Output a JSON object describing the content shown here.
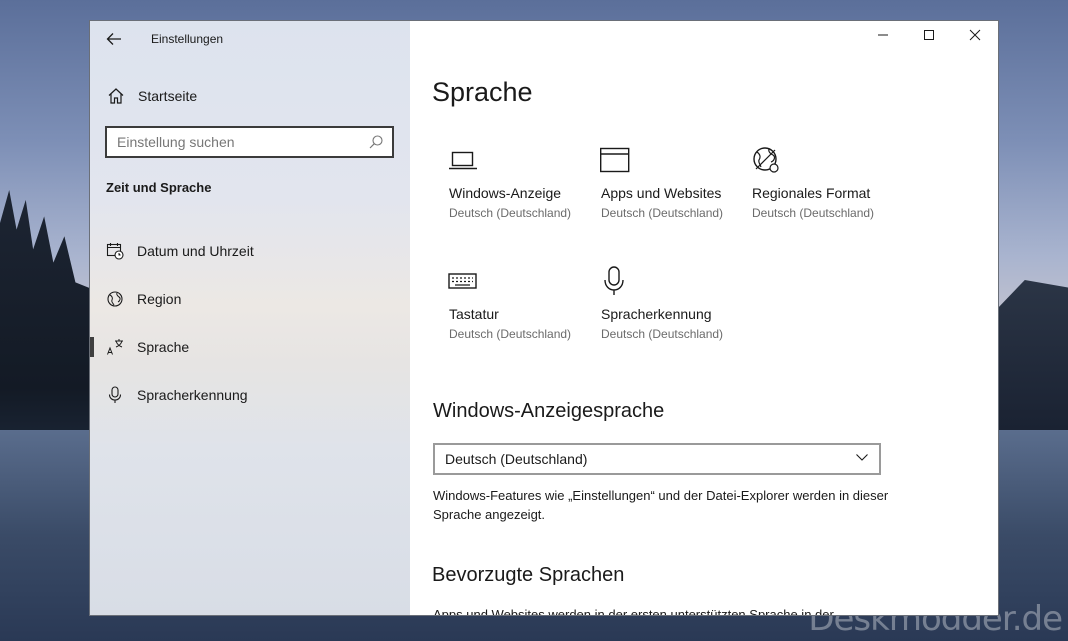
{
  "window": {
    "title": "Einstellungen"
  },
  "sidebar": {
    "home_label": "Startseite",
    "search_placeholder": "Einstellung suchen",
    "section_title": "Zeit und Sprache",
    "items": [
      {
        "label": "Datum und Uhrzeit",
        "icon": "calendar-clock-icon",
        "active": false
      },
      {
        "label": "Region",
        "icon": "globe-icon",
        "active": false
      },
      {
        "label": "Sprache",
        "icon": "language-icon",
        "active": true
      },
      {
        "label": "Spracherkennung",
        "icon": "microphone-icon",
        "active": false
      }
    ]
  },
  "main": {
    "title": "Sprache",
    "tiles": [
      {
        "name": "Windows-Anzeige",
        "sub": "Deutsch (Deutschland)",
        "icon": "laptop-icon"
      },
      {
        "name": "Apps und Websites",
        "sub": "Deutsch (Deutschland)",
        "icon": "window-icon"
      },
      {
        "name": "Regionales Format",
        "sub": "Deutsch (Deutschland)",
        "icon": "globe-settings-icon"
      },
      {
        "name": "Tastatur",
        "sub": "Deutsch (Deutschland)",
        "icon": "keyboard-icon"
      },
      {
        "name": "Spracherkennung",
        "sub": "Deutsch (Deutschland)",
        "icon": "microphone-icon"
      }
    ],
    "display_language": {
      "heading": "Windows-Anzeigesprache",
      "selected": "Deutsch (Deutschland)",
      "description": "Windows-Features wie „Einstellungen“ und der Datei-Explorer werden in dieser Sprache angezeigt."
    },
    "preferred_languages": {
      "heading": "Bevorzugte Sprachen",
      "text_partial": "Apps und Websites werden in der ersten unterstützten Sprache in der"
    }
  },
  "watermark": "Deskmodder.de",
  "colors": {
    "accent": "#3f3f3f",
    "secondary_text": "#6b6b6b"
  }
}
